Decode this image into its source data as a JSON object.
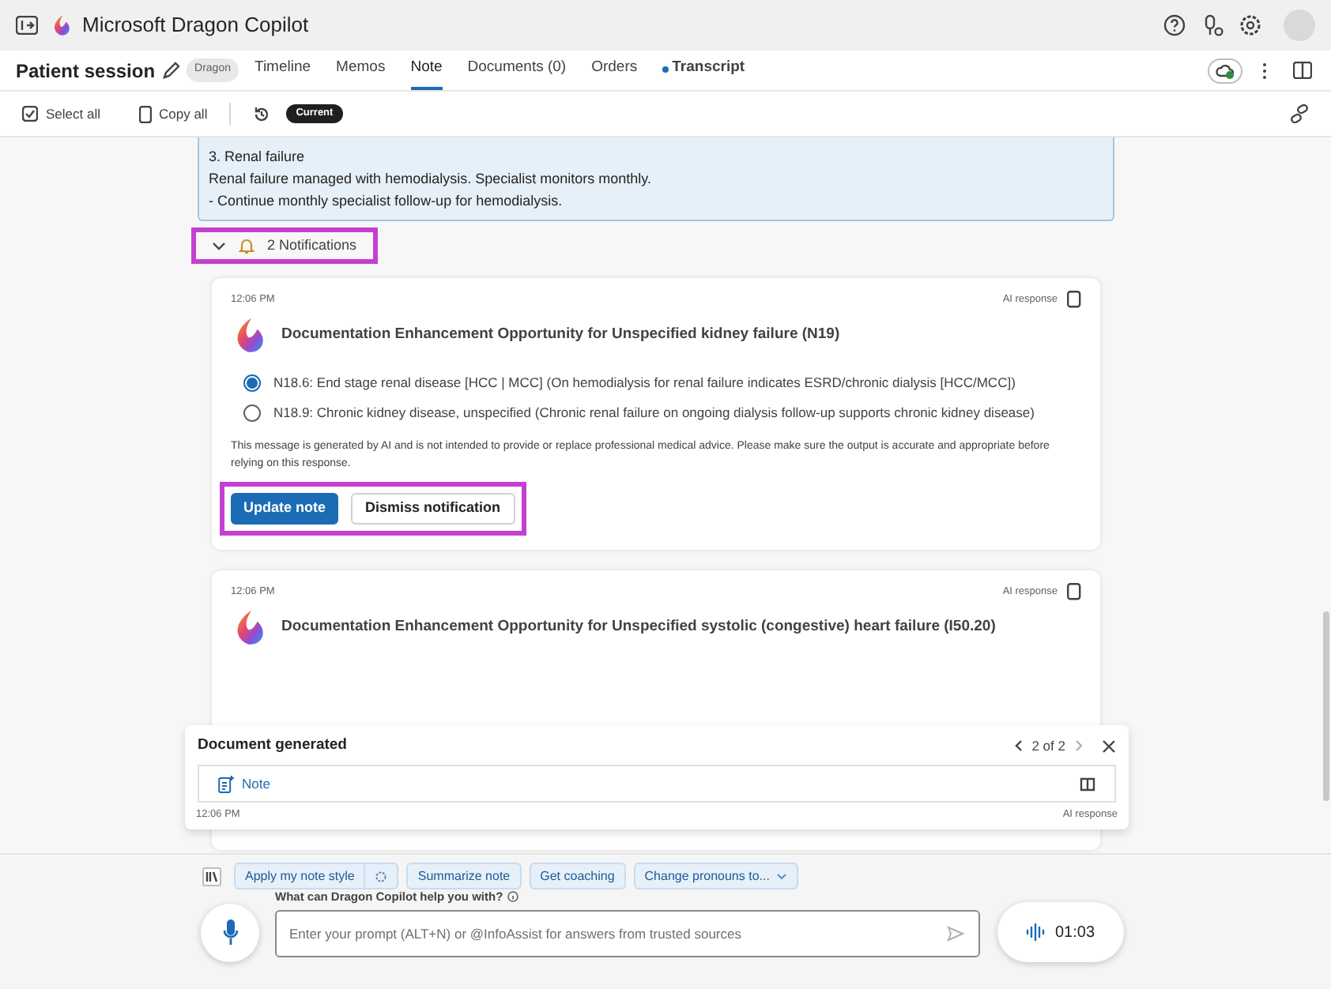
{
  "window": {
    "title": "Microsoft Dragon Copilot"
  },
  "session": {
    "title": "Patient session",
    "badge": "Dragon"
  },
  "tabs": [
    {
      "label": "Timeline",
      "selected": false,
      "dot": false
    },
    {
      "label": "Memos",
      "selected": false,
      "dot": false
    },
    {
      "label": "Note",
      "selected": true,
      "dot": false
    },
    {
      "label": "Documents (0)",
      "selected": false,
      "dot": false
    },
    {
      "label": "Orders",
      "selected": false,
      "dot": false
    },
    {
      "label": "Transcript",
      "selected": false,
      "dot": true
    }
  ],
  "toolbar": {
    "select_all": "Select all",
    "copy_all": "Copy all",
    "version": "Current"
  },
  "note_text": [
    "3. Renal failure",
    "Renal failure managed with hemodialysis. Specialist monitors monthly.",
    "- Continue monthly specialist follow-up for hemodialysis."
  ],
  "notifications": {
    "label": "2 Notifications",
    "expanded": true,
    "highlighted": true
  },
  "cards": [
    {
      "time": "12:06 PM",
      "source": "AI response",
      "title": "Documentation Enhancement Opportunity for Unspecified kidney failure (N19)",
      "options": [
        {
          "label": "N18.6: End stage renal disease [HCC | MCC] (On hemodialysis for renal failure indicates ESRD/chronic dialysis [HCC/MCC])",
          "selected": true
        },
        {
          "label": "N18.9: Chronic kidney disease, unspecified (Chronic renal failure on ongoing dialysis follow-up supports chronic kidney disease)",
          "selected": false
        }
      ],
      "disclaimer": "This message is generated by AI and is not intended to provide or replace professional medical advice. Please make sure the output is accurate and appropriate before relying on this response.",
      "primary": "Update note",
      "secondary": "Dismiss notification",
      "actions_highlighted": true
    },
    {
      "time": "12:06 PM",
      "source": "AI response",
      "title": "Documentation Enhancement Opportunity for Unspecified systolic (congestive) heart failure (I50.20)"
    }
  ],
  "popup": {
    "title": "Document generated",
    "pager": "2 of 2",
    "item": "Note",
    "time": "12:06 PM",
    "source": "AI response"
  },
  "suggestions": [
    "Apply my note style",
    "Summarize note",
    "Get coaching",
    "Change pronouns to..."
  ],
  "prompt": {
    "label": "What can Dragon Copilot help you with?",
    "placeholder": "Enter your prompt (ALT+N) or @InfoAssist for answers from trusted sources"
  },
  "recording": {
    "time": "01:03"
  }
}
